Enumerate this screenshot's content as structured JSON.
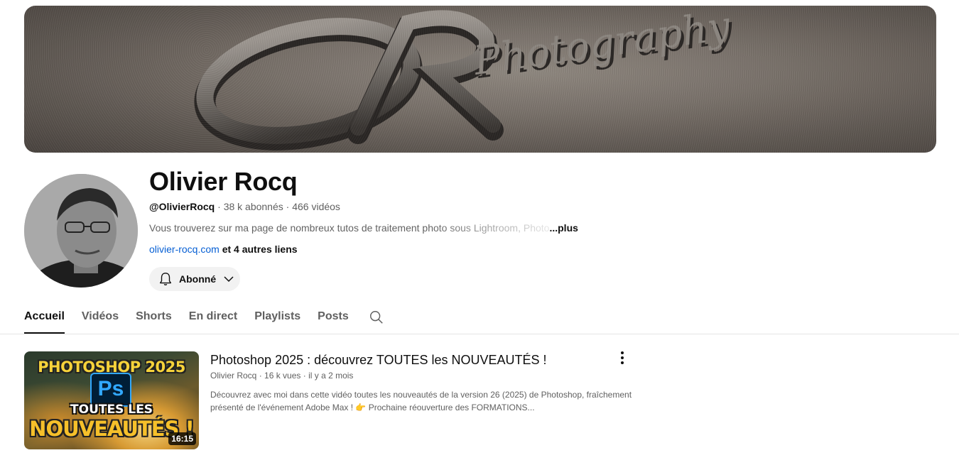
{
  "channel": {
    "name": "Olivier Rocq",
    "handle": "@OlivierRocq",
    "subscribers": "38 k abonnés",
    "videos": "466 vidéos",
    "separator": " · ",
    "description": "Vous trouverez sur ma page de nombreux tutos de traitement photo sous Lightroom, Photo",
    "more_label": "...plus",
    "link_site": "olivier-rocq.com",
    "link_more": "et 4 autres liens",
    "subscribe_label": "Abonné"
  },
  "tabs": [
    {
      "label": "Accueil",
      "active": true
    },
    {
      "label": "Vidéos"
    },
    {
      "label": "Shorts"
    },
    {
      "label": "En direct"
    },
    {
      "label": "Playlists"
    },
    {
      "label": "Posts"
    }
  ],
  "featured_video": {
    "title": "Photoshop 2025 : découvrez TOUTES les NOUVEAUTÉS !",
    "channel": "Olivier Rocq",
    "views": "16 k vues",
    "age": "il y a 2 mois",
    "description_line1": "Découvrez avec moi dans cette vidéo toutes les nouveautés de la version 26 (2025) de Photoshop, fraîchement",
    "description_line2": "présenté de l'événement Adobe Max ! 👉 Prochaine réouverture des FORMATIONS...",
    "duration": "16:15",
    "thumbnail_text": {
      "line1": "PHOTOSHOP 2025",
      "logo": "Ps",
      "line2": "TOUTES LES",
      "line3": "NOUVEAUTÉS !"
    }
  },
  "banner_text": {
    "monogram": "OR",
    "script": "Photography"
  },
  "colors": {
    "link": "#065fd4",
    "muted": "#606060",
    "text": "#0f0f0f",
    "chip": "#f2f2f2"
  }
}
